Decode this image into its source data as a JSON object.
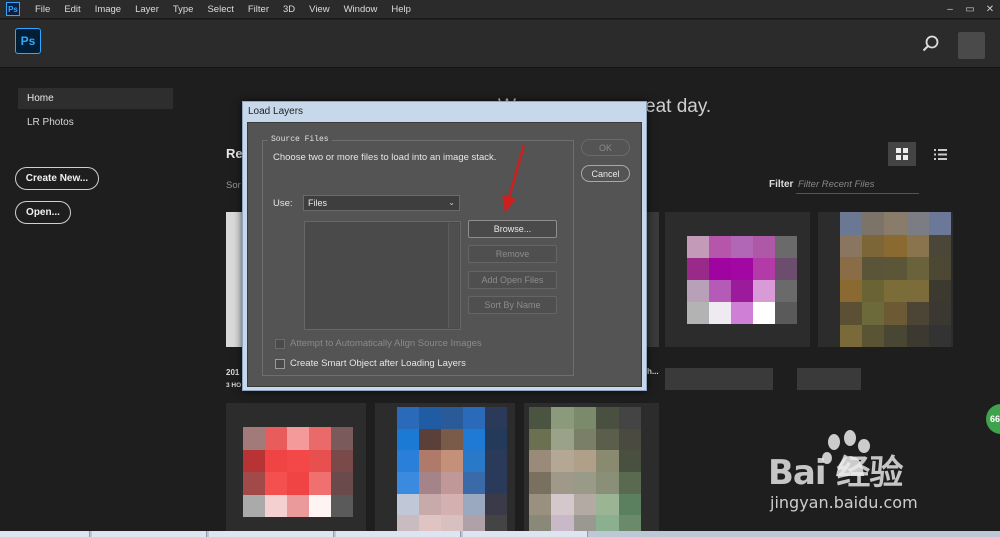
{
  "menu": {
    "app_icon": "Ps",
    "items": [
      "File",
      "Edit",
      "Image",
      "Layer",
      "Type",
      "Select",
      "Filter",
      "3D",
      "View",
      "Window",
      "Help"
    ],
    "window_controls": [
      "–",
      "▭",
      "✕"
    ]
  },
  "header": {
    "logo": "Ps",
    "search_icon": "search-icon"
  },
  "sidebar": {
    "home": "Home",
    "lr_photos": "LR Photos",
    "create_new": "Create New...",
    "open": "Open..."
  },
  "main": {
    "greeting_left": "W",
    "greeting_right": "eat day.",
    "recent_title": "Re",
    "sort_label": "Sor",
    "filter_label": "Filter",
    "filter_placeholder": "Filter Recent Files",
    "card1_name": "201",
    "card1_meta": "3 HO",
    "card3_meta": "h..."
  },
  "badge": "66",
  "watermark": {
    "main": "Bai  经验",
    "url": "jingyan.baidu.com"
  },
  "dialog": {
    "title": "Load Layers",
    "group_legend": "Source Files",
    "instruction": "Choose two or more files to load into an image stack.",
    "use_label": "Use:",
    "use_value": "Files",
    "buttons": {
      "browse": "Browse...",
      "remove": "Remove",
      "add_open": "Add Open Files",
      "sort": "Sort By Name"
    },
    "ok": "OK",
    "cancel": "Cancel",
    "checkbox_align": "Attempt to Automatically Align Source Images",
    "checkbox_smart": "Create Smart Object after Loading Layers"
  },
  "colors": {
    "accent": "#31a8ff",
    "arrow": "#cc1f1f"
  }
}
